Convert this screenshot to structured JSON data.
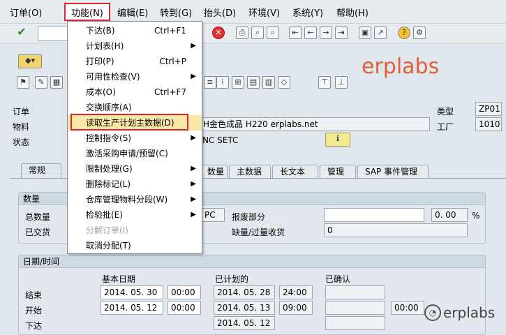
{
  "menubar": {
    "items": [
      "订单(O)",
      "功能(N)",
      "编辑(E)",
      "转到(G)",
      "抬头(D)",
      "环境(V)",
      "系统(Y)",
      "帮助(H)"
    ]
  },
  "dropdown": {
    "items": [
      {
        "label": "下达(B)",
        "shortcut": "Ctrl+F1",
        "submenu": false,
        "disabled": false
      },
      {
        "label": "计划表(H)",
        "shortcut": "",
        "submenu": true,
        "disabled": false
      },
      {
        "label": "打印(P)",
        "shortcut": "Ctrl+P",
        "submenu": false,
        "disabled": false
      },
      {
        "label": "可用性检查(V)",
        "shortcut": "",
        "submenu": true,
        "disabled": false
      },
      {
        "label": "成本(O)",
        "shortcut": "Ctrl+F7",
        "submenu": false,
        "disabled": false
      },
      {
        "label": "交换顺序(A)",
        "shortcut": "",
        "submenu": false,
        "disabled": false
      },
      {
        "label": "读取生产计划主数据(D)",
        "shortcut": "",
        "submenu": false,
        "disabled": false
      },
      {
        "label": "控制指令(S)",
        "shortcut": "",
        "submenu": true,
        "disabled": false
      },
      {
        "label": "激活采购申请/预留(C)",
        "shortcut": "",
        "submenu": false,
        "disabled": false
      },
      {
        "label": "限制处理(G)",
        "shortcut": "",
        "submenu": true,
        "disabled": false
      },
      {
        "label": "删除标记(L)",
        "shortcut": "",
        "submenu": true,
        "disabled": false
      },
      {
        "label": "仓库管理物料分段(W)",
        "shortcut": "",
        "submenu": true,
        "disabled": false
      },
      {
        "label": "检验批(E)",
        "shortcut": "",
        "submenu": true,
        "disabled": false
      },
      {
        "label": "分解订单(I)",
        "shortcut": "",
        "submenu": false,
        "disabled": true
      },
      {
        "label": "取消分配(T)",
        "shortcut": "",
        "submenu": false,
        "disabled": false
      }
    ]
  },
  "header": {
    "order_label": "订单",
    "material_label": "物料",
    "status_label": "状态",
    "material_desc": "H金色成品 H220 erplabs.net",
    "status_text": "NC SETC",
    "type_label": "类型",
    "type_value": "ZP01",
    "plant_label": "工厂",
    "plant_value": "1010"
  },
  "tabs": [
    "常规",
    "数量",
    "主数据",
    "长文本",
    "管理",
    "SAP 事件管理"
  ],
  "quantity": {
    "title": "数量",
    "total_label": "总数量",
    "delivered_label": "已交货",
    "unit": "PC",
    "scrap_label": "报废部分",
    "scrap_value": "0. 00",
    "scrap_unit": "%",
    "short_label": "缺量/过量收货",
    "short_value": "0"
  },
  "dates": {
    "title": "日期/时间",
    "basic_label": "基本日期",
    "scheduled_label": "已计划的",
    "confirmed_label": "已确认",
    "end_label": "结束",
    "start_label": "开始",
    "release_label": "下达",
    "end_basic_date": "2014. 05. 30",
    "end_basic_time": "00:00",
    "end_sched_date": "2014. 05. 28",
    "end_sched_time": "24:00",
    "start_basic_date": "2014. 05. 12",
    "start_basic_time": "00:00",
    "start_sched_date": "2014. 05. 13",
    "start_sched_time": "09:00",
    "start_conf_time": "00:00",
    "release_sched_date": "2014. 05. 12"
  },
  "watermarks": {
    "top": "erplabs",
    "bottom": "erplabs"
  },
  "colors": {
    "highlight_border": "#e0262c",
    "menu_hover": "#fbe7a8",
    "watermark": "#e0603a"
  }
}
